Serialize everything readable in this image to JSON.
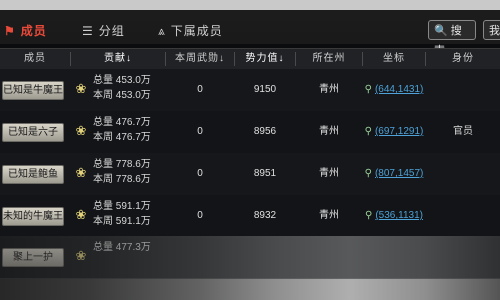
{
  "tabs": [
    {
      "label": "成员",
      "icon": "banner-icon",
      "active": true
    },
    {
      "label": "分组",
      "icon": "list-icon",
      "active": false
    },
    {
      "label": "下属成员",
      "icon": "hierarchy-icon",
      "active": false
    }
  ],
  "buttons": {
    "search_label": "搜索",
    "my_label": "我"
  },
  "columns": [
    "成员",
    "贡献↓",
    "本周武勋↓",
    "势力值↓",
    "所在州",
    "坐标",
    "身份"
  ],
  "rows": [
    {
      "name": "已知是牛魔王",
      "total": "总量 453.0万",
      "week": "本周 453.0万",
      "merit": "0",
      "power": "9150",
      "state": "青州",
      "coord": "(644,1431)",
      "title": ""
    },
    {
      "name": "已知是六子",
      "total": "总量 476.7万",
      "week": "本周 476.7万",
      "merit": "0",
      "power": "8956",
      "state": "青州",
      "coord": "(697,1291)",
      "title": "官员"
    },
    {
      "name": "已知是鲍鱼",
      "total": "总量 778.6万",
      "week": "本周 778.6万",
      "merit": "0",
      "power": "8951",
      "state": "青州",
      "coord": "(807,1457)",
      "title": ""
    },
    {
      "name": "未知的牛魔王",
      "total": "总量 591.1万",
      "week": "本周 591.1万",
      "merit": "0",
      "power": "8932",
      "state": "青州",
      "coord": "(536,1131)",
      "title": ""
    },
    {
      "name": "聚上一护",
      "total": "总量 477.3万",
      "week": "",
      "merit": "",
      "power": "",
      "state": "",
      "coord": "",
      "title": ""
    }
  ],
  "colors": {
    "accent": "#e84a3a",
    "link": "#4ea2d8",
    "background": "#0b0c0e"
  }
}
